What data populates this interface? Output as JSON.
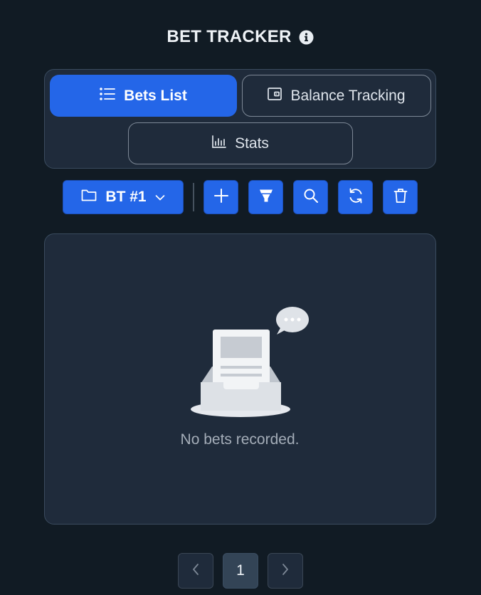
{
  "header": {
    "title": "BET TRACKER",
    "info_icon": "info-circle-icon"
  },
  "tabs": [
    {
      "label": "Bets List",
      "icon": "list-icon",
      "active": true
    },
    {
      "label": "Balance Tracking",
      "icon": "wallet-icon",
      "active": false
    },
    {
      "label": "Stats",
      "icon": "bar-chart-icon",
      "active": false
    }
  ],
  "toolbar": {
    "folder_label": "BT #1",
    "folder_icon": "folder-icon",
    "dropdown_icon": "chevron-down-icon",
    "actions": [
      {
        "name": "add",
        "icon": "plus-icon"
      },
      {
        "name": "filter",
        "icon": "funnel-icon"
      },
      {
        "name": "search",
        "icon": "search-icon"
      },
      {
        "name": "refresh",
        "icon": "refresh-icon"
      },
      {
        "name": "delete",
        "icon": "trash-icon"
      }
    ]
  },
  "content": {
    "empty_message": "No bets recorded.",
    "illustration": "empty-inbox-icon"
  },
  "pagination": {
    "current_page": "1",
    "prev_icon": "chevron-left-icon",
    "next_icon": "chevron-right-icon"
  },
  "colors": {
    "background": "#111b24",
    "panel": "#1f2b3b",
    "accent": "#2466e8",
    "border": "#3a4b5e",
    "muted_text": "#a4adb8"
  }
}
